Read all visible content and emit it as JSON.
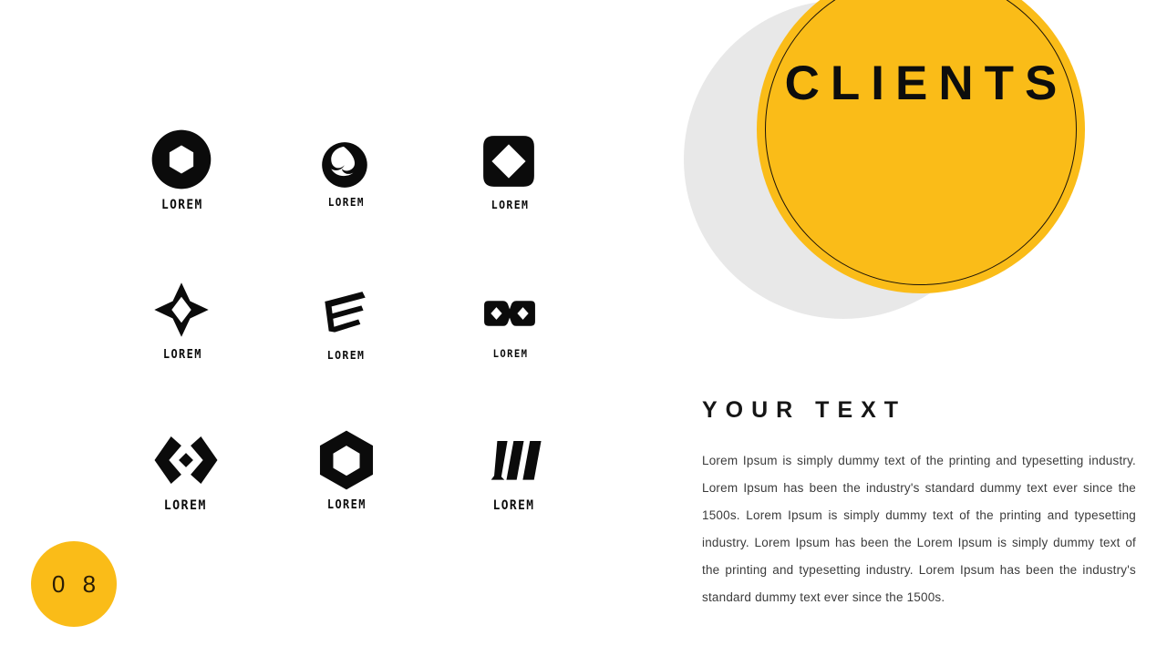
{
  "slide": {
    "page_number": "0 8",
    "background_color": "#ffffff",
    "accent_color": "#fabc18",
    "shadow_color": "#e8e8e8",
    "ink_color": "#0d0d0d"
  },
  "hero": {
    "title": "CLIENTS",
    "circle_color": "#fabc18",
    "shadow_circle_color": "#e8e8e8",
    "outline_color": "#1a1208"
  },
  "text_block": {
    "heading": "YOUR TEXT",
    "body": "Lorem Ipsum is simply dummy text of the printing and typesetting industry. Lorem Ipsum has been the industry's standard dummy text ever since the 1500s. Lorem Ipsum is simply dummy text of the printing and typesetting industry. Lorem Ipsum has been the Lorem Ipsum is simply dummy text of the printing and typesetting industry. Lorem Ipsum has been the industry's standard dummy text ever since the 1500s."
  },
  "logos": [
    {
      "label": "LOREM",
      "icon": "thick-ring-logo"
    },
    {
      "label": "LOREM",
      "icon": "swirl-pinwheel-logo"
    },
    {
      "label": "LOREM",
      "icon": "rounded-square-diamond-logo"
    },
    {
      "label": "LOREM",
      "icon": "four-point-star-logo"
    },
    {
      "label": "LOREM",
      "icon": "stacked-arrow-bars-logo"
    },
    {
      "label": "LOREM",
      "icon": "infinity-diamonds-logo"
    },
    {
      "label": "LOREM",
      "icon": "double-chevron-diamond-logo"
    },
    {
      "label": "LOREM",
      "icon": "hexagon-ring-logo"
    },
    {
      "label": "LOREM",
      "icon": "three-slanted-bars-logo"
    }
  ]
}
